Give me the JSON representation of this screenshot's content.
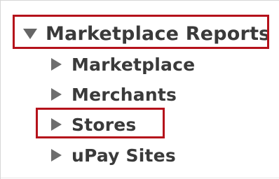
{
  "tree": {
    "root": {
      "label": "Marketplace Reports",
      "expanded": true,
      "icon": "triangle-down-icon"
    },
    "children": [
      {
        "label": "Marketplace",
        "icon": "triangle-right-icon"
      },
      {
        "label": "Merchants",
        "icon": "triangle-right-icon"
      },
      {
        "label": "Stores",
        "icon": "triangle-right-icon"
      },
      {
        "label": "uPay Sites",
        "icon": "triangle-right-icon"
      }
    ]
  },
  "colors": {
    "highlight": "#b5121b",
    "text": "#3a3a3a",
    "triangle": "#6e6e6e"
  }
}
